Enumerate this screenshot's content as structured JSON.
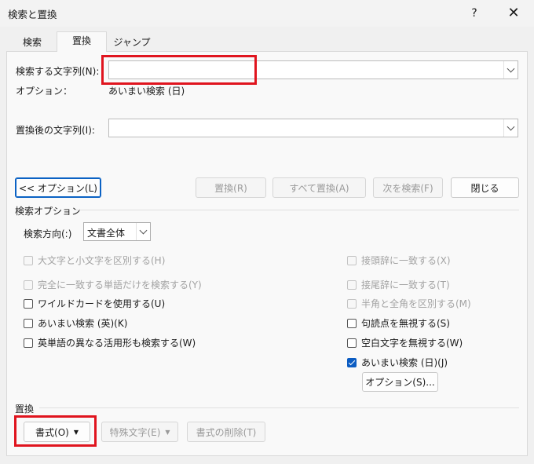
{
  "window": {
    "title": "検索と置換",
    "help": "?",
    "close": "✕"
  },
  "tabs": [
    {
      "label": "検索"
    },
    {
      "label": "置換"
    },
    {
      "label": "ジャンプ"
    }
  ],
  "find": {
    "label": "検索する文字列(N):",
    "value": ""
  },
  "options_line": {
    "label": "オプション：",
    "value": "あいまい検索 (日)"
  },
  "replace": {
    "label": "置換後の文字列(I):",
    "value": ""
  },
  "buttons": {
    "less_options": "<< オプション(L)",
    "replace": "置換(R)",
    "replace_all": "すべて置換(A)",
    "find_next": "次を検索(F)",
    "close": "閉じる"
  },
  "search_options": {
    "title": "検索オプション",
    "direction_label": "検索方向(:)",
    "direction_value": "文書全体",
    "left": [
      {
        "label": "大文字と小文字を区別する(H)",
        "checked": false,
        "disabled": true
      },
      {
        "label": "完全に一致する単語だけを検索する(Y)",
        "checked": false,
        "disabled": true
      },
      {
        "label": "ワイルドカードを使用する(U)",
        "checked": false,
        "disabled": false
      },
      {
        "label": "あいまい検索 (英)(K)",
        "checked": false,
        "disabled": false
      },
      {
        "label": "英単語の異なる活用形も検索する(W)",
        "checked": false,
        "disabled": false
      }
    ],
    "right": [
      {
        "label": "接頭辞に一致する(X)",
        "checked": false,
        "disabled": true
      },
      {
        "label": "接尾辞に一致する(T)",
        "checked": false,
        "disabled": true
      },
      {
        "label": "半角と全角を区別する(M)",
        "checked": false,
        "disabled": true
      },
      {
        "label": "句読点を無視する(S)",
        "checked": false,
        "disabled": false
      },
      {
        "label": "空白文字を無視する(W)",
        "checked": false,
        "disabled": false
      },
      {
        "label": "あいまい検索 (日)(J)",
        "checked": true,
        "disabled": false
      }
    ],
    "fuzzy_options_button": "オプション(S)..."
  },
  "replace_group": {
    "title": "置換",
    "format_button": "書式(O)",
    "special_button": "特殊文字(E)",
    "clear_format_button": "書式の削除(T)"
  },
  "colors": {
    "highlight": "#e0141e",
    "accent": "#0b5cc2"
  }
}
